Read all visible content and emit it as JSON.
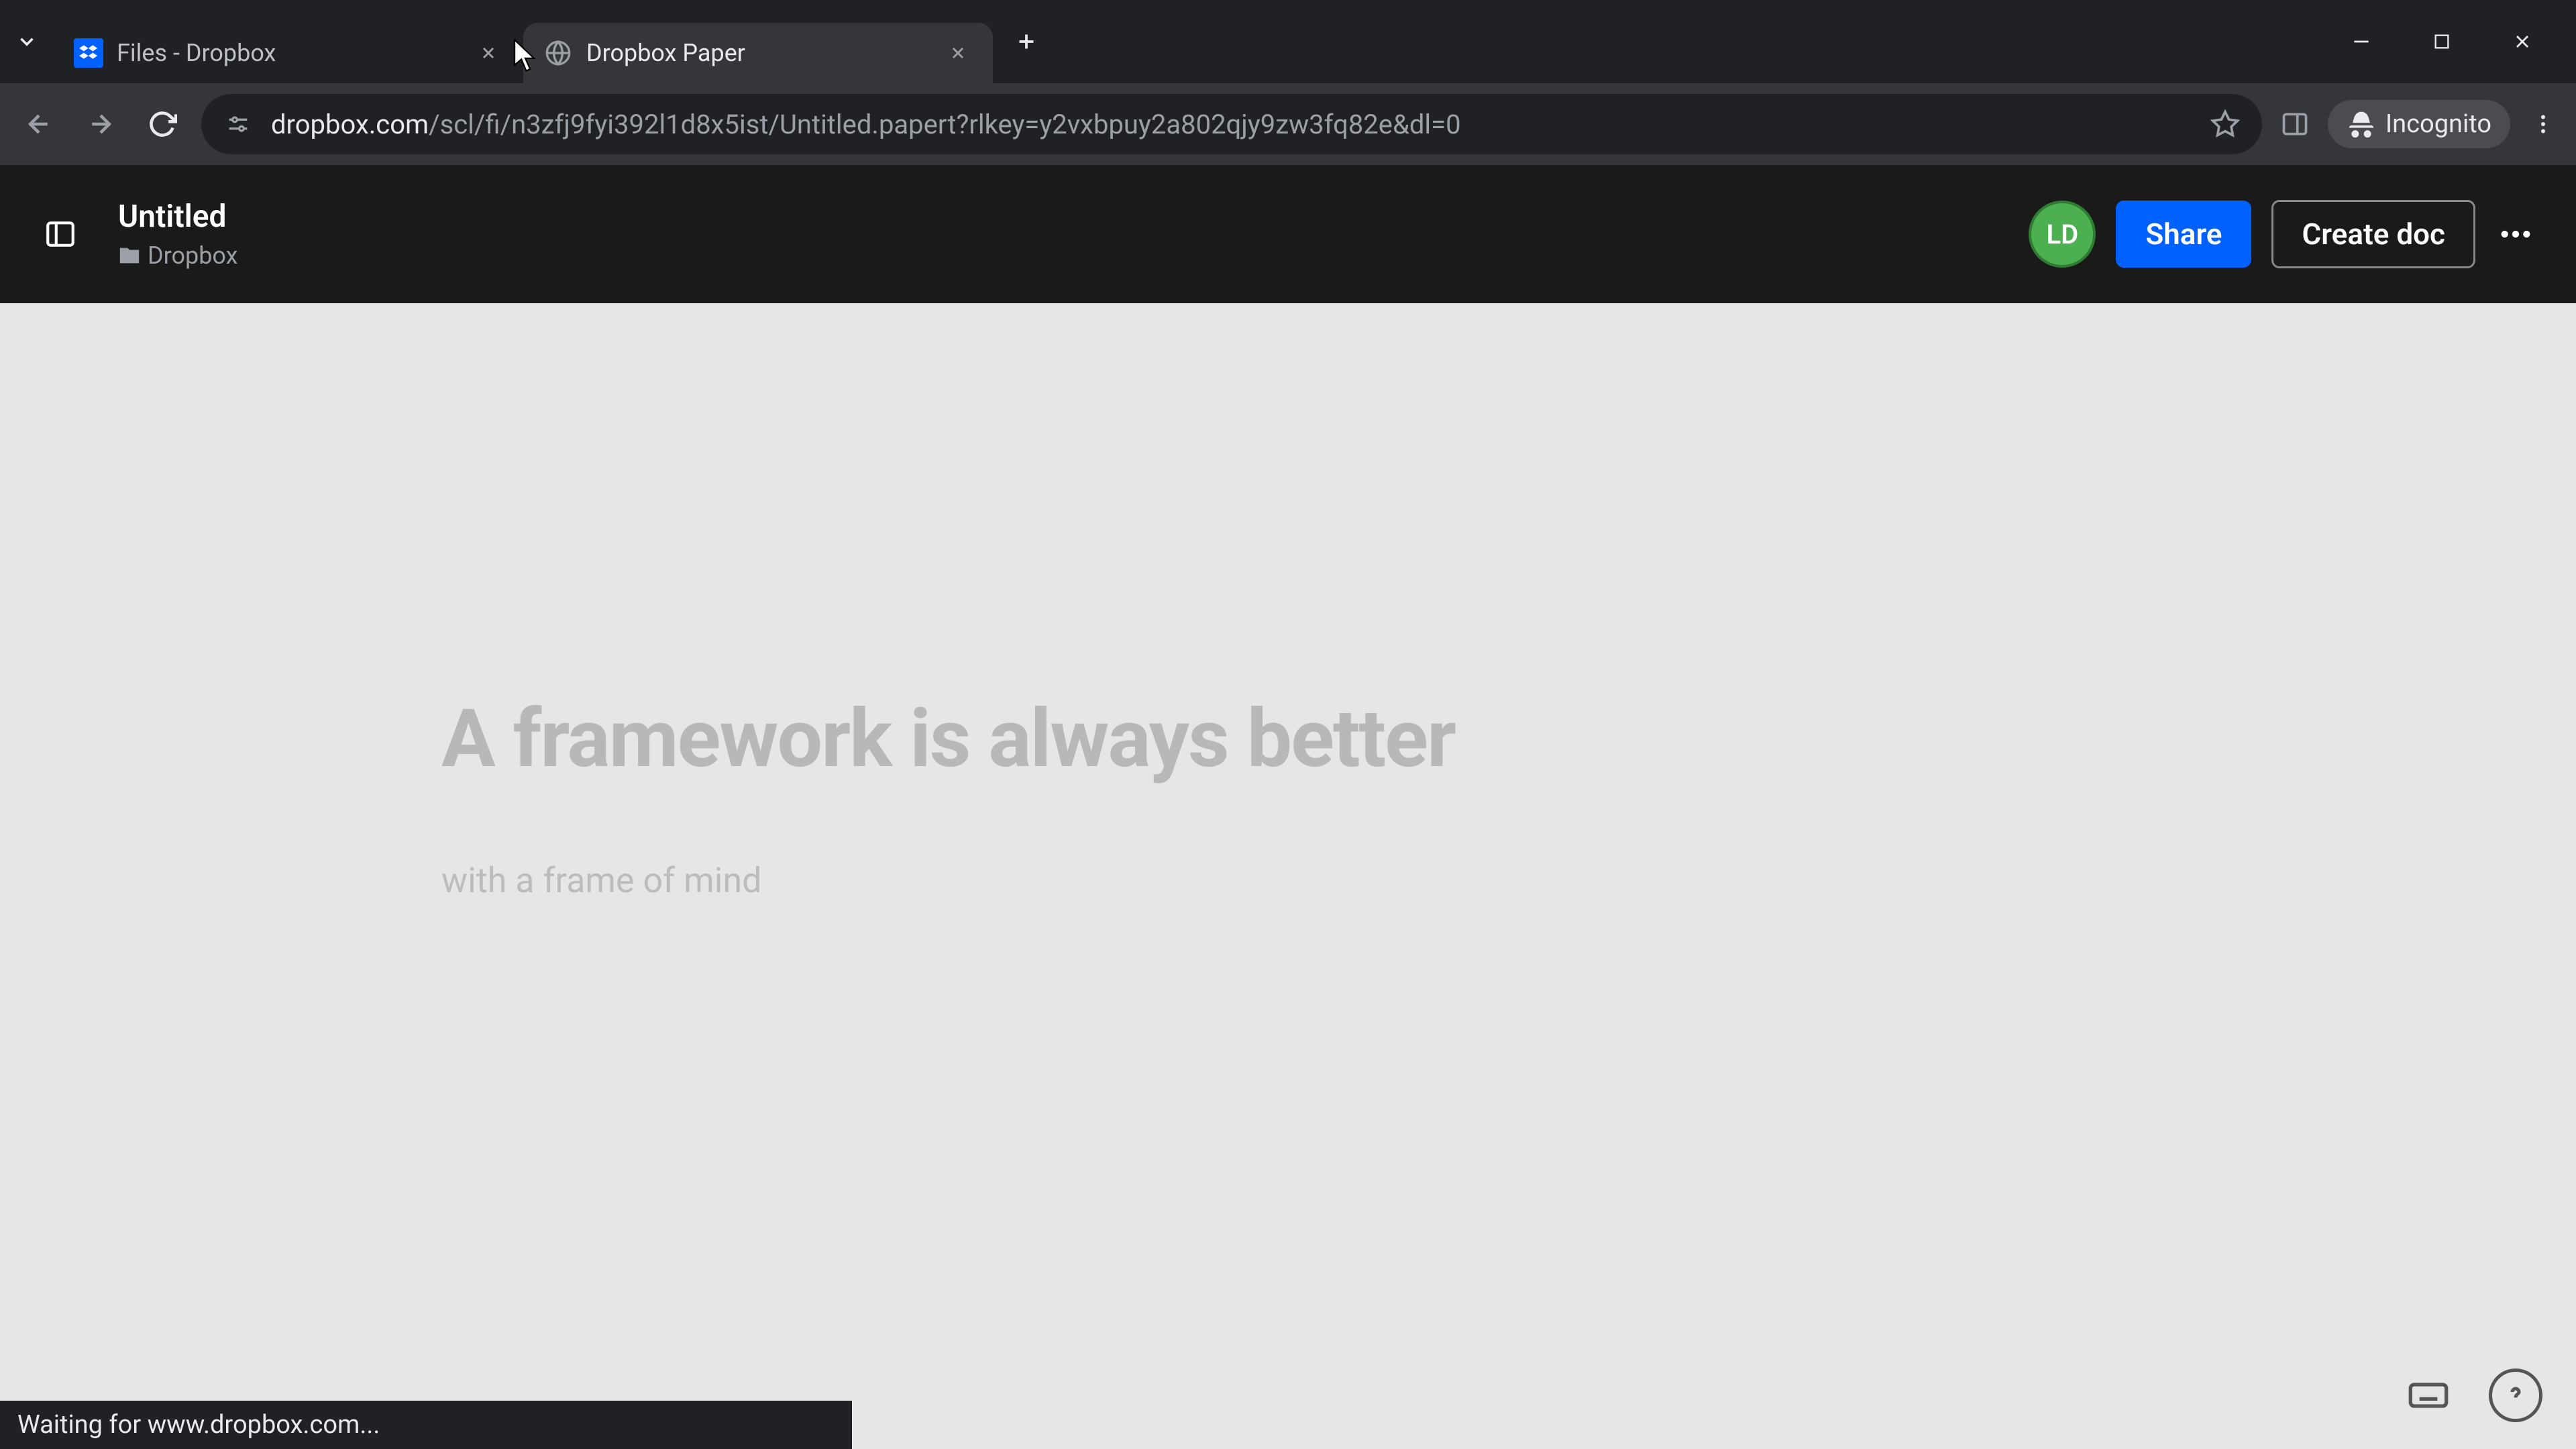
{
  "browser": {
    "tabs": [
      {
        "title": "Files - Dropbox",
        "favicon": "dropbox",
        "active": false
      },
      {
        "title": "Dropbox Paper",
        "favicon": "globe",
        "active": true
      }
    ],
    "url_host": "dropbox.com",
    "url_path": "/scl/fi/n3zfj9fyi392l1d8x5ist/Untitled.papert?rlkey=y2vxbpuy2a802qjy9zw3fq82e&dl=0",
    "incognito_label": "Incognito"
  },
  "app_header": {
    "doc_title": "Untitled",
    "breadcrumb_folder": "Dropbox",
    "avatar_initials": "LD",
    "share_label": "Share",
    "create_doc_label": "Create doc"
  },
  "document": {
    "heading_placeholder": "A framework is always better",
    "body_placeholder": "with a frame of mind"
  },
  "status_bar": {
    "text": "Waiting for www.dropbox.com..."
  },
  "colors": {
    "chrome_bg": "#202124",
    "toolbar_bg": "#35363a",
    "header_bg": "#1a1a1a",
    "canvas_bg": "#e6e6e6",
    "share_blue": "#0061fe",
    "avatar_green": "#4caf50"
  }
}
